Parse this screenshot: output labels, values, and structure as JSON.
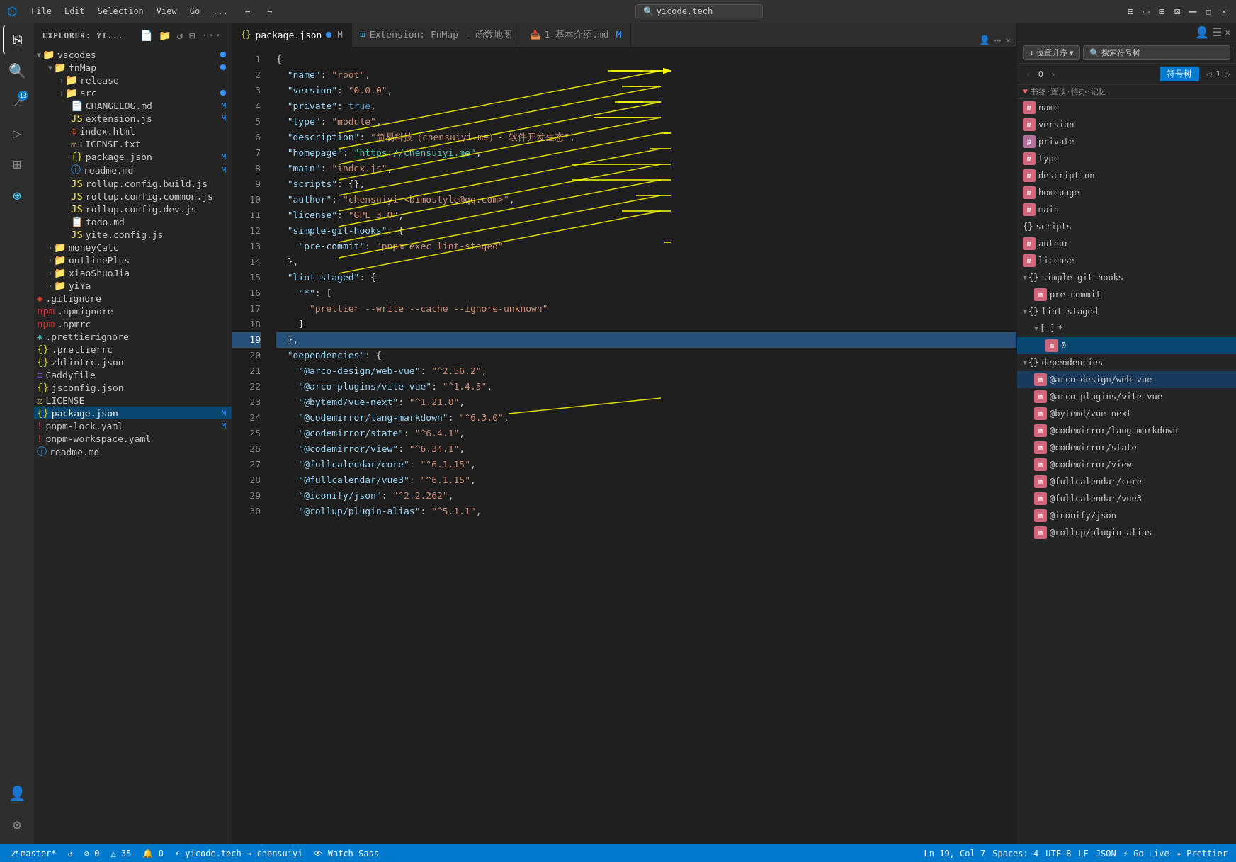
{
  "titleBar": {
    "logo": "VS",
    "menuItems": [
      "File",
      "Edit",
      "Selection",
      "View",
      "Go",
      "..."
    ],
    "navBack": "←",
    "navForward": "→",
    "searchPlaceholder": "yicode.tech",
    "winControls": [
      "⊟",
      "❐",
      "✕"
    ]
  },
  "activityBar": {
    "icons": [
      {
        "name": "explorer-icon",
        "symbol": "⎘",
        "active": true
      },
      {
        "name": "search-icon",
        "symbol": "🔍",
        "active": false
      },
      {
        "name": "source-control-icon",
        "symbol": "⎇",
        "active": false,
        "badge": "13"
      },
      {
        "name": "run-icon",
        "symbol": "▷",
        "active": false
      },
      {
        "name": "extensions-icon",
        "symbol": "⊞",
        "active": false
      },
      {
        "name": "remote-icon",
        "symbol": "⊕",
        "active": false
      }
    ],
    "bottomIcons": [
      {
        "name": "account-icon",
        "symbol": "👤"
      },
      {
        "name": "settings-icon",
        "symbol": "⚙"
      }
    ]
  },
  "sidebar": {
    "title": "EXPLORER: YI...",
    "items": [
      {
        "indent": 4,
        "label": "vscodes",
        "type": "folder",
        "expanded": true,
        "dot": true
      },
      {
        "indent": 20,
        "label": "fnMap",
        "type": "folder",
        "expanded": true,
        "dot": true
      },
      {
        "indent": 36,
        "label": "release",
        "type": "folder",
        "expanded": false,
        "dot": false
      },
      {
        "indent": 36,
        "label": "src",
        "type": "folder",
        "expanded": false,
        "dot": true
      },
      {
        "indent": 36,
        "label": "CHANGELOG.md",
        "type": "md",
        "badge": "M"
      },
      {
        "indent": 36,
        "label": "extension.js",
        "type": "js",
        "badge": "M"
      },
      {
        "indent": 36,
        "label": "index.html",
        "type": "html"
      },
      {
        "indent": 36,
        "label": "LICENSE.txt",
        "type": "txt"
      },
      {
        "indent": 36,
        "label": "package.json",
        "type": "json",
        "badge": "M"
      },
      {
        "indent": 36,
        "label": "readme.md",
        "type": "md",
        "badge": "M"
      },
      {
        "indent": 36,
        "label": "rollup.config.build.js",
        "type": "js"
      },
      {
        "indent": 36,
        "label": "rollup.config.common.js",
        "type": "js"
      },
      {
        "indent": 36,
        "label": "rollup.config.dev.js",
        "type": "js"
      },
      {
        "indent": 36,
        "label": "todo.md",
        "type": "md"
      },
      {
        "indent": 36,
        "label": "yite.config.js",
        "type": "js"
      },
      {
        "indent": 20,
        "label": "moneyCalc",
        "type": "folder",
        "expanded": false
      },
      {
        "indent": 20,
        "label": "outlinePlus",
        "type": "folder",
        "expanded": false
      },
      {
        "indent": 20,
        "label": "xiaoShuoJia",
        "type": "folder",
        "expanded": false
      },
      {
        "indent": 20,
        "label": "yiYa",
        "type": "folder",
        "expanded": false
      },
      {
        "indent": 4,
        "label": ".gitignore",
        "type": "git"
      },
      {
        "indent": 4,
        "label": ".npmignore",
        "type": "npm"
      },
      {
        "indent": 4,
        "label": ".npmrc",
        "type": "npm"
      },
      {
        "indent": 4,
        "label": ".prettierignore",
        "type": "prettier"
      },
      {
        "indent": 4,
        "label": ".prettierrc",
        "type": "prettier"
      },
      {
        "indent": 4,
        "label": "zhlintrc.json",
        "type": "json"
      },
      {
        "indent": 4,
        "label": "Caddyfile",
        "type": "file"
      },
      {
        "indent": 4,
        "label": "jsconfig.json",
        "type": "json"
      },
      {
        "indent": 4,
        "label": "LICENSE",
        "type": "license"
      },
      {
        "indent": 4,
        "label": "package.json",
        "type": "json",
        "active": true,
        "badge": "M"
      },
      {
        "indent": 4,
        "label": "pnpm-lock.yaml",
        "type": "yaml",
        "badge": "M"
      },
      {
        "indent": 4,
        "label": "pnpm-workspace.yaml",
        "type": "yaml"
      },
      {
        "indent": 4,
        "label": "readme.md",
        "type": "md"
      }
    ]
  },
  "tabs": [
    {
      "label": "package.json",
      "icon": "{}",
      "active": true,
      "modified": true,
      "closeable": true,
      "subtitle": "M"
    },
    {
      "label": "Extension: FnMap - 函数地图",
      "icon": "⊞",
      "active": false,
      "closeable": false
    },
    {
      "label": "1-基本介绍.md",
      "icon": "📝",
      "active": false,
      "modified": true,
      "subtitle": "M",
      "closeable": false
    }
  ],
  "editor": {
    "lines": [
      {
        "num": 1,
        "content": "{"
      },
      {
        "num": 2,
        "content": "  \"name\": \"root\","
      },
      {
        "num": 3,
        "content": "  \"version\": \"0.0.0\","
      },
      {
        "num": 4,
        "content": "  \"private\": true,"
      },
      {
        "num": 5,
        "content": "  \"type\": \"module\","
      },
      {
        "num": 6,
        "content": "  \"description\": \"简易科技（chensuiyi.me）- 软件开发生态\","
      },
      {
        "num": 7,
        "content": "  \"homepage\": \"https://chensuiyi.me\","
      },
      {
        "num": 8,
        "content": "  \"main\": \"index.js\","
      },
      {
        "num": 9,
        "content": "  \"scripts\": {},"
      },
      {
        "num": 10,
        "content": "  \"author\": \"chensuiyi <bimostyle@qq.com>\","
      },
      {
        "num": 11,
        "content": "  \"license\": \"GPL 3.0\","
      },
      {
        "num": 12,
        "content": "  \"simple-git-hooks\": {"
      },
      {
        "num": 13,
        "content": "    \"pre-commit\": \"pnpm exec lint-staged\""
      },
      {
        "num": 14,
        "content": "  },"
      },
      {
        "num": 15,
        "content": "  \"lint-staged\": {"
      },
      {
        "num": 16,
        "content": "    \"*\": ["
      },
      {
        "num": 17,
        "content": "      \"prettier --write --cache --ignore-unknown\""
      },
      {
        "num": 18,
        "content": "    ]"
      },
      {
        "num": 19,
        "content": "  },",
        "highlight": true
      },
      {
        "num": 20,
        "content": "  \"dependencies\": {"
      },
      {
        "num": 21,
        "content": "    \"@arco-design/web-vue\": \"^2.56.2\","
      },
      {
        "num": 22,
        "content": "    \"@arco-plugins/vite-vue\": \"^1.4.5\","
      },
      {
        "num": 23,
        "content": "    \"@bytemd/vue-next\": \"^1.21.0\","
      },
      {
        "num": 24,
        "content": "    \"@codemirror/lang-markdown\": \"^6.3.0\","
      },
      {
        "num": 25,
        "content": "    \"@codemirror/state\": \"^6.4.1\","
      },
      {
        "num": 26,
        "content": "    \"@codemirror/view\": \"^6.34.1\","
      },
      {
        "num": 27,
        "content": "    \"@fullcalendar/core\": \"^6.1.15\","
      },
      {
        "num": 28,
        "content": "    \"@fullcalendar/vue3\": \"^6.1.15\","
      },
      {
        "num": 29,
        "content": "    \"@iconify/json\": \"^2.2.262\","
      },
      {
        "num": 30,
        "content": "    \"@rollup/plugin-alias\": \"^5.1.1\","
      }
    ]
  },
  "rightPanel": {
    "sortLabel": "位置升序",
    "searchLabel": "搜索符号树",
    "navPrev": "‹",
    "navNext": "›",
    "navCount": "0",
    "navTotal": ">",
    "symbolTreeLabel": "符号树",
    "navLeft": "◁",
    "navRight": "▷",
    "pageNum": "1",
    "pageSlash": "/",
    "bookmarkLabel": "书签·置顶·待办·记忆",
    "heart": "♥",
    "symbols": [
      {
        "indent": 0,
        "type": "m",
        "label": "name",
        "expanded": false
      },
      {
        "indent": 0,
        "type": "m",
        "label": "version",
        "expanded": false
      },
      {
        "indent": 0,
        "type": "p",
        "label": "private",
        "expanded": false
      },
      {
        "indent": 0,
        "type": "m",
        "label": "type",
        "expanded": false
      },
      {
        "indent": 0,
        "type": "m",
        "label": "description",
        "expanded": false
      },
      {
        "indent": 0,
        "type": "m",
        "label": "homepage",
        "expanded": false
      },
      {
        "indent": 0,
        "type": "m",
        "label": "main",
        "expanded": false
      },
      {
        "indent": 0,
        "type": "b",
        "label": "scripts",
        "expanded": false
      },
      {
        "indent": 0,
        "type": "m",
        "label": "author",
        "expanded": false
      },
      {
        "indent": 0,
        "type": "m",
        "label": "license",
        "expanded": false
      },
      {
        "indent": 0,
        "type": "b",
        "label": "simple-git-hooks",
        "expanded": true
      },
      {
        "indent": 16,
        "type": "m",
        "label": "pre-commit",
        "expanded": false
      },
      {
        "indent": 0,
        "type": "b",
        "label": "lint-staged",
        "expanded": true
      },
      {
        "indent": 16,
        "type": "a",
        "label": "[ ] *",
        "expanded": true
      },
      {
        "indent": 32,
        "type": "m",
        "label": "0",
        "active": true
      },
      {
        "indent": 0,
        "type": "b",
        "label": "dependencies",
        "expanded": true
      },
      {
        "indent": 16,
        "type": "m",
        "label": "@arco-design/web-vue",
        "selected": true
      },
      {
        "indent": 16,
        "type": "m",
        "label": "@arco-plugins/vite-vue"
      },
      {
        "indent": 16,
        "type": "m",
        "label": "@bytemd/vue-next"
      },
      {
        "indent": 16,
        "type": "m",
        "label": "@codemirror/lang-markdown"
      },
      {
        "indent": 16,
        "type": "m",
        "label": "@codemirror/state"
      },
      {
        "indent": 16,
        "type": "m",
        "label": "@codemirror/view"
      },
      {
        "indent": 16,
        "type": "m",
        "label": "@fullcalendar/core"
      },
      {
        "indent": 16,
        "type": "m",
        "label": "@fullcalendar/vue3"
      },
      {
        "indent": 16,
        "type": "m",
        "label": "@iconify/json"
      },
      {
        "indent": 16,
        "type": "m",
        "label": "@rollup/plugin-alias"
      }
    ]
  },
  "statusBar": {
    "branch": "master*",
    "syncIcon": "↺",
    "errors": "⊘ 0",
    "warnings": "△ 35",
    "info": "🔔 0",
    "cursor": "Ln 19, Col 7",
    "spaces": "Spaces: 4",
    "encoding": "UTF-8",
    "lineEnding": "LF",
    "language": "JSON",
    "siteUrl": "⚡ yicode.tech → chensuiyi",
    "watchSass": "👁 Watch Sass",
    "goLive": "⚡ Go Live",
    "prettier": "✦ Prettier"
  }
}
